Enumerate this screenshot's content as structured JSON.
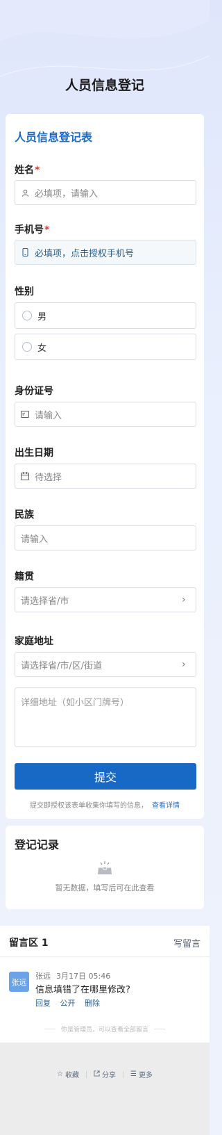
{
  "page": {
    "title": "人员信息登记"
  },
  "form": {
    "title": "人员信息登记表",
    "name": {
      "label": "姓名",
      "required_mark": "*",
      "placeholder": "必填项，请输入"
    },
    "phone": {
      "label": "手机号",
      "required_mark": "*",
      "placeholder": "必填项，点击授权手机号"
    },
    "gender": {
      "label": "性别",
      "options": [
        "男",
        "女"
      ]
    },
    "id_card": {
      "label": "身份证号",
      "placeholder": "请输入"
    },
    "birth_date": {
      "label": "出生日期",
      "placeholder": "待选择"
    },
    "ethnicity": {
      "label": "民族",
      "placeholder": "请输入"
    },
    "native_place": {
      "label": "籍贯",
      "placeholder": "请选择省/市"
    },
    "address": {
      "label": "家庭地址",
      "region_placeholder": "请选择省/市/区/街道",
      "detail_placeholder": "详细地址（如小区门牌号）"
    },
    "submit_label": "提交",
    "privacy_text": "提交即授权该表单收集你填写的信息，",
    "privacy_link": "查看详情"
  },
  "records": {
    "title": "登记记录",
    "empty_text": "暂无数据，填写后可在此查看"
  },
  "comments": {
    "title": "留言区 1",
    "write_label": "写留言",
    "items": [
      {
        "avatar_text": "张远",
        "author": "张远",
        "time": "3月17日 05:46",
        "text": "信息填错了在哪里修改?",
        "actions": [
          "回复",
          "公开",
          "删除"
        ]
      }
    ],
    "admin_note": "你是管理员，可以查看全部留言"
  },
  "footer": {
    "actions": [
      {
        "icon": "star-icon",
        "label": "收藏"
      },
      {
        "icon": "share-icon",
        "label": "分享"
      },
      {
        "icon": "menu-icon",
        "label": "更多"
      }
    ]
  },
  "colors": {
    "accent": "#1769c5",
    "required": "#e53935",
    "avatar": "#6aa3e8"
  }
}
